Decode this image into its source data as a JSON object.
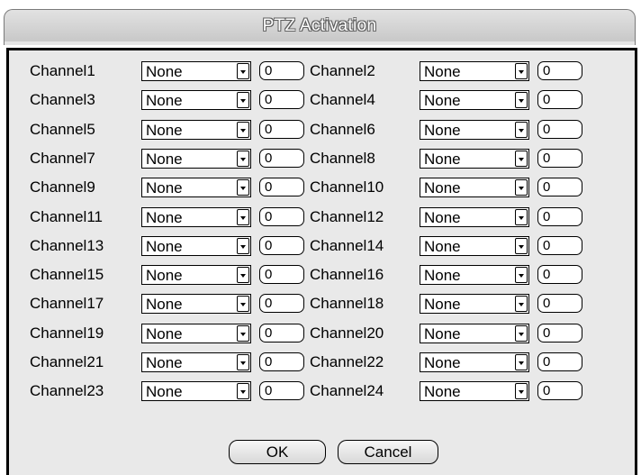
{
  "dialog": {
    "title": "PTZ Activation"
  },
  "channels": [
    {
      "label": "Channel1",
      "value": "None",
      "number": "0"
    },
    {
      "label": "Channel2",
      "value": "None",
      "number": "0"
    },
    {
      "label": "Channel3",
      "value": "None",
      "number": "0"
    },
    {
      "label": "Channel4",
      "value": "None",
      "number": "0"
    },
    {
      "label": "Channel5",
      "value": "None",
      "number": "0"
    },
    {
      "label": "Channel6",
      "value": "None",
      "number": "0"
    },
    {
      "label": "Channel7",
      "value": "None",
      "number": "0"
    },
    {
      "label": "Channel8",
      "value": "None",
      "number": "0"
    },
    {
      "label": "Channel9",
      "value": "None",
      "number": "0"
    },
    {
      "label": "Channel10",
      "value": "None",
      "number": "0"
    },
    {
      "label": "Channel11",
      "value": "None",
      "number": "0"
    },
    {
      "label": "Channel12",
      "value": "None",
      "number": "0"
    },
    {
      "label": "Channel13",
      "value": "None",
      "number": "0"
    },
    {
      "label": "Channel14",
      "value": "None",
      "number": "0"
    },
    {
      "label": "Channel15",
      "value": "None",
      "number": "0"
    },
    {
      "label": "Channel16",
      "value": "None",
      "number": "0"
    },
    {
      "label": "Channel17",
      "value": "None",
      "number": "0"
    },
    {
      "label": "Channel18",
      "value": "None",
      "number": "0"
    },
    {
      "label": "Channel19",
      "value": "None",
      "number": "0"
    },
    {
      "label": "Channel20",
      "value": "None",
      "number": "0"
    },
    {
      "label": "Channel21",
      "value": "None",
      "number": "0"
    },
    {
      "label": "Channel22",
      "value": "None",
      "number": "0"
    },
    {
      "label": "Channel23",
      "value": "None",
      "number": "0"
    },
    {
      "label": "Channel24",
      "value": "None",
      "number": "0"
    }
  ],
  "buttons": {
    "ok": "OK",
    "cancel": "Cancel"
  },
  "colors": {
    "panel": "#e9e9e9",
    "title_bar": "#d0d0d0",
    "border": "#000000"
  }
}
